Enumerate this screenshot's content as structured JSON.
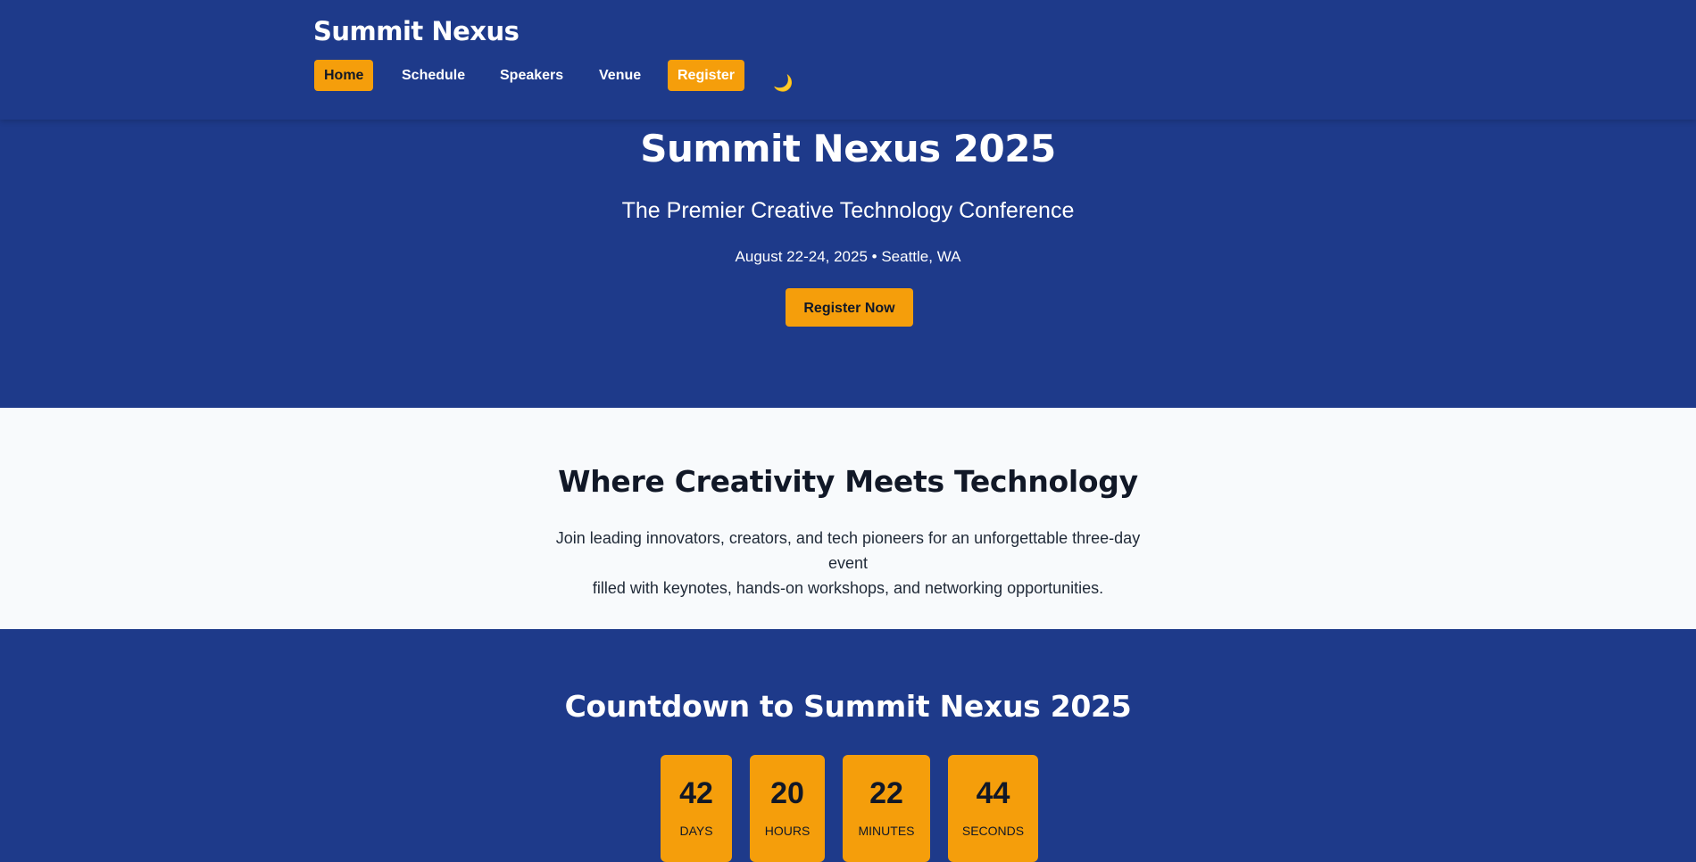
{
  "header": {
    "brand": "Summit Nexus",
    "nav": [
      {
        "label": "Home",
        "active": true
      },
      {
        "label": "Schedule"
      },
      {
        "label": "Speakers"
      },
      {
        "label": "Venue"
      },
      {
        "label": "Register",
        "cta": true
      }
    ],
    "theme_toggle_icon": "moon-icon",
    "theme_toggle_glyph": "🌙"
  },
  "hero": {
    "title": "Summit Nexus 2025",
    "subtitle": "The Premier Creative Technology Conference",
    "dates": "August 22-24, 2025 • Seattle, WA",
    "button": "Register Now"
  },
  "about": {
    "title": "Where Creativity Meets Technology",
    "line1": "Join leading innovators, creators, and tech pioneers for an unforgettable three-day event",
    "line2": "filled with keynotes, hands-on workshops, and networking opportunities."
  },
  "countdown": {
    "title": "Countdown to Summit Nexus 2025",
    "items": [
      {
        "value": "42",
        "label": "DAYS"
      },
      {
        "value": "20",
        "label": "HOURS"
      },
      {
        "value": "22",
        "label": "MINUTES"
      },
      {
        "value": "44",
        "label": "SECONDS"
      }
    ]
  },
  "colors": {
    "primary": "#1e3a8a",
    "accent": "#f59e0b",
    "light_bg": "#f8fafc",
    "dark_text": "#111827"
  }
}
